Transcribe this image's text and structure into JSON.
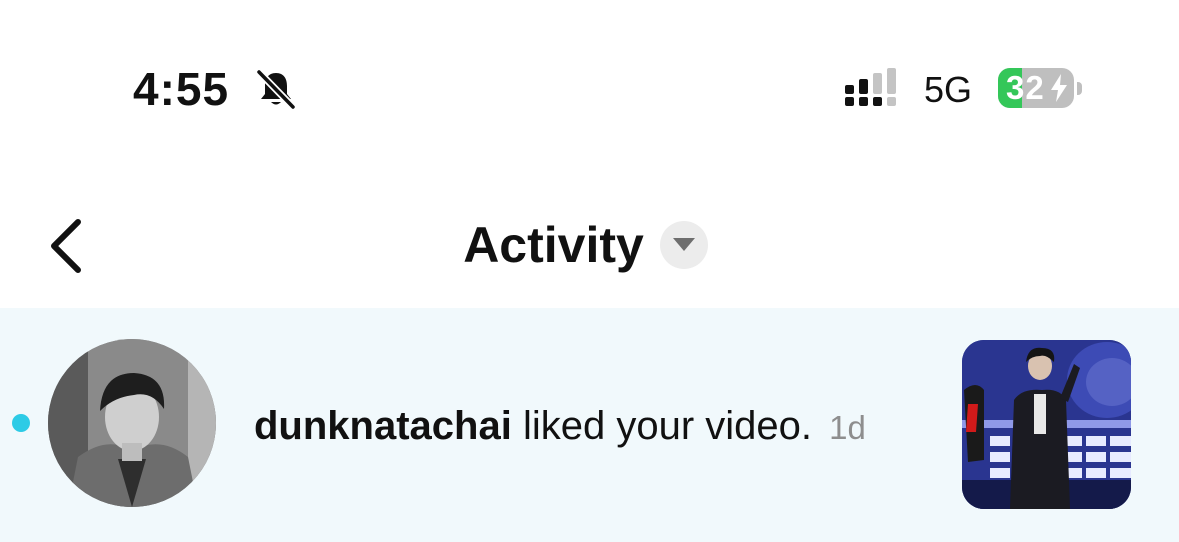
{
  "status_bar": {
    "time": "4:55",
    "silent_icon": "bell-slash-icon",
    "signal_icon": "cellular-signal-icon",
    "network": "5G",
    "battery_percent": "32",
    "battery_level": 0.32,
    "battery_charging_icon": "bolt-icon",
    "colors": {
      "battery_fill": "#34c759",
      "battery_empty": "#bfbfbf"
    }
  },
  "header": {
    "back_icon": "chevron-left-icon",
    "title": "Activity",
    "dropdown_icon": "caret-down-icon"
  },
  "activity": {
    "items": [
      {
        "unread": true,
        "avatar": "user-avatar",
        "username": "dunknatachai",
        "action": " liked your video.",
        "time_ago": "1d",
        "thumbnail": "video-thumbnail"
      }
    ],
    "colors": {
      "row_background": "#f1f9fc",
      "unread_dot": "#2dcbe6"
    }
  }
}
